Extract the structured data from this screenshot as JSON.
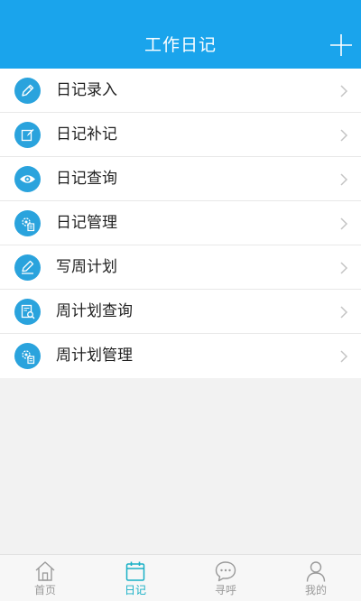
{
  "header": {
    "title": "工作日记",
    "add_icon": "plus-icon"
  },
  "menu": {
    "items": [
      {
        "label": "日记录入",
        "icon": "pencil-icon"
      },
      {
        "label": "日记补记",
        "icon": "edit-note-icon"
      },
      {
        "label": "日记查询",
        "icon": "eye-icon"
      },
      {
        "label": "日记管理",
        "icon": "gear-document-icon"
      },
      {
        "label": "写周计划",
        "icon": "pen-write-icon"
      },
      {
        "label": "周计划查询",
        "icon": "document-search-icon"
      },
      {
        "label": "周计划管理",
        "icon": "gear-document-icon"
      }
    ]
  },
  "tabbar": {
    "tabs": [
      {
        "label": "首页",
        "icon": "home-icon",
        "active": false
      },
      {
        "label": "日记",
        "icon": "calendar-icon",
        "active": true
      },
      {
        "label": "寻呼",
        "icon": "chat-bubble-icon",
        "active": false
      },
      {
        "label": "我的",
        "icon": "user-icon",
        "active": false
      }
    ]
  },
  "colors": {
    "header": "#1aa4ec",
    "icon_circle": "#2aa3dd",
    "tab_active": "#18b0c6",
    "tab_inactive": "#9a9a9a"
  }
}
